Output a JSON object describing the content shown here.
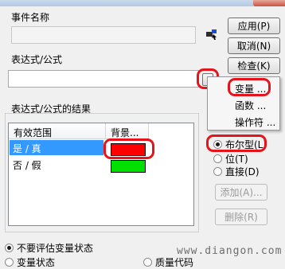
{
  "form": {
    "event_name_label": "事件名称",
    "event_name_value": "",
    "expression_label": "表达式/公式",
    "expression_value": "",
    "browse_label": ".",
    "results_label": "表达式/公式的结果",
    "table": {
      "columns": [
        "有效范围",
        "背景..."
      ],
      "rows": [
        {
          "range": "是 / 真",
          "color": "#ff0000",
          "selected": true
        },
        {
          "range": "否 / 假",
          "color": "#00e000",
          "selected": false
        }
      ]
    },
    "radios": [
      {
        "label": "布尔型(L)",
        "checked": true
      },
      {
        "label": "位(T)",
        "checked": false
      },
      {
        "label": "直接(D)",
        "checked": false
      }
    ],
    "add_label": "添加(A)...",
    "delete_label": "删除(R)",
    "bottom_radios": [
      {
        "label": "不要评估变量状态",
        "checked": true
      },
      {
        "label": "变量状态",
        "checked": false
      },
      {
        "label": "质量代码",
        "checked": false
      }
    ]
  },
  "buttons": {
    "apply": "应用(P)",
    "cancel": "取消(N)",
    "check": "检查(K)"
  },
  "menu": {
    "items": [
      "变量 ...",
      "函数 ...",
      "操作符 ..."
    ]
  },
  "watermark": "www.diangon.com",
  "highlight_color": "#e5141b"
}
